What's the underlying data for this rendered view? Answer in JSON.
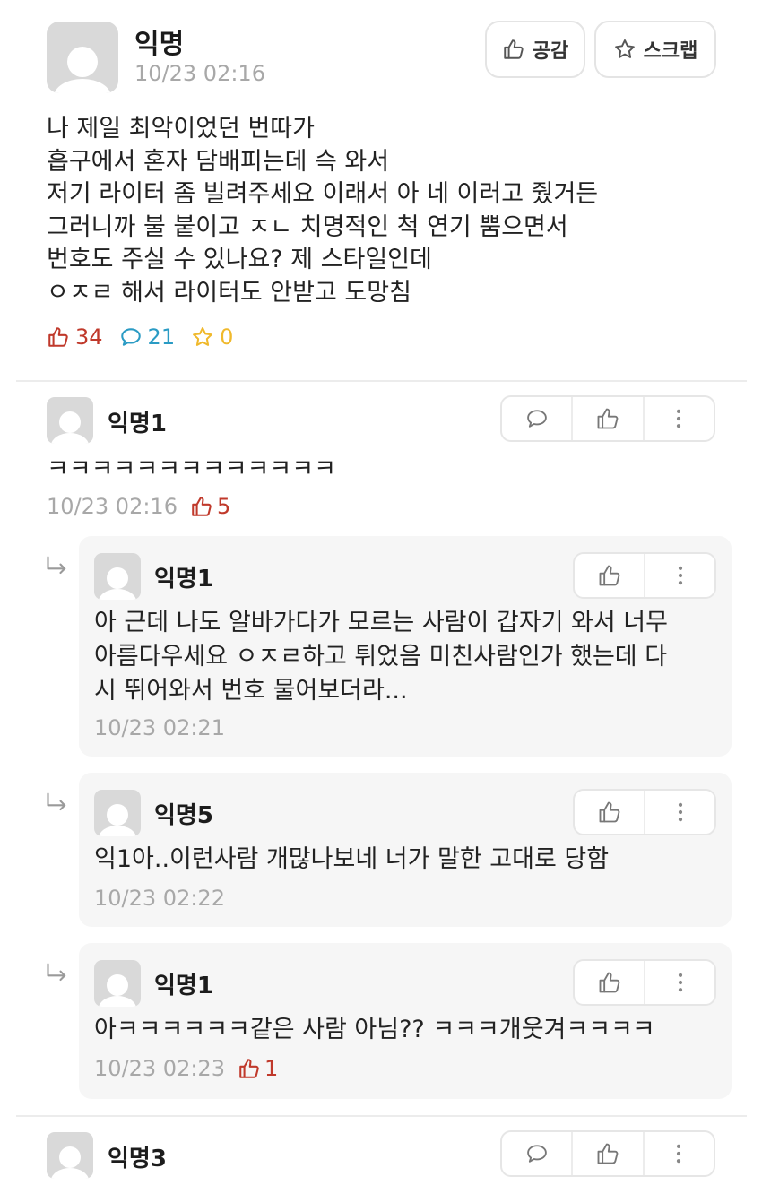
{
  "post": {
    "author": "익명",
    "time": "10/23 02:16",
    "like_button": "공감",
    "scrap_button": "스크랩",
    "body_lines": [
      "나 제일 최악이었던 번따가",
      "흡구에서 혼자 담배피는데 슥 와서",
      "저기 라이터 좀 빌려주세요 이래서 아 네 이러고 줬거든",
      "그러니까 불 붙이고 ㅈㄴ 치명적인 척 연기 뿜으면서",
      "번호도 주실 수 있나요? 제 스타일인데",
      "ㅇㅈㄹ 해서 라이터도 안받고 도망침"
    ],
    "likes": "34",
    "comments": "21",
    "scraps": "0"
  },
  "comments": [
    {
      "author": "익명1",
      "text": "ㅋㅋㅋㅋㅋㅋㅋㅋㅋㅋㅋㅋㅋ",
      "time": "10/23 02:16",
      "likes": "5"
    },
    {
      "author": "익명3"
    }
  ],
  "replies": [
    {
      "author": "익명1",
      "lines": [
        "아 근데 나도 알바가다가 모르는 사람이 갑자기 와서 너무",
        "아름다우세요 ㅇㅈㄹ하고 튀었음 미친사람인가 했는데 다",
        "시 뛰어와서 번호 물어보더라..."
      ],
      "time": "10/23 02:21"
    },
    {
      "author": "익명5",
      "lines": [
        "익1아..이런사람 개많나보네 너가 말한 고대로 당함"
      ],
      "time": "10/23 02:22"
    },
    {
      "author": "익명1",
      "lines": [
        "아ㅋㅋㅋㅋㅋㅋ같은 사람 아님?? ㅋㅋㅋ개웃겨ㅋㅋㅋㅋ"
      ],
      "time": "10/23 02:23",
      "likes": "1"
    }
  ],
  "colors": {
    "like_red": "#c0392b",
    "comment_blue": "#2a9bc4",
    "scrap_yellow": "#f0b92c",
    "muted_gray": "#a8a8a8"
  },
  "icons": [
    "thumbs-up-icon",
    "star-icon",
    "speech-bubble-icon",
    "more-vertical-icon",
    "reply-arrow-icon"
  ]
}
